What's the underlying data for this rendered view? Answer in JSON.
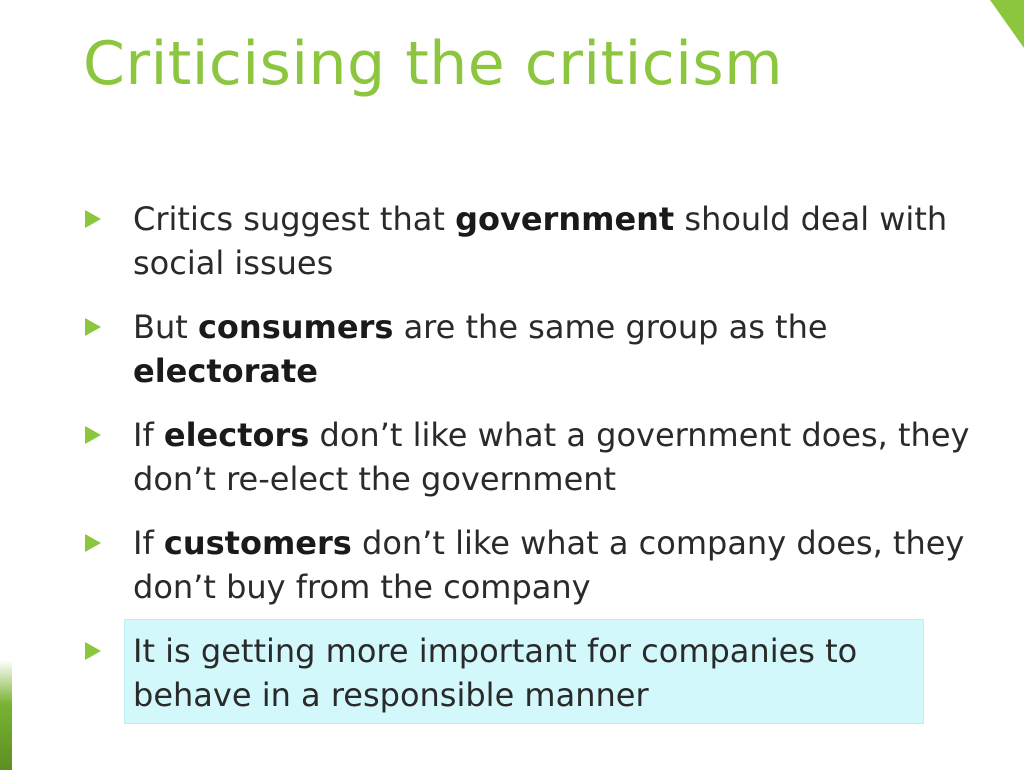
{
  "slide": {
    "title": "Criticising the criticism",
    "colors": {
      "accent": "#8cc63f",
      "text": "#2a2a2a",
      "highlight": "#d3f8fb"
    },
    "bullets": [
      {
        "before": "Critics suggest that ",
        "bold": "government",
        "after": " should deal with social issues"
      },
      {
        "before": "But ",
        "bold": "consumers",
        "middle": " are the same group as the ",
        "bold2": "electorate"
      },
      {
        "before": "If ",
        "bold": "electors",
        "after": " don’t like what a government does, they don’t re-elect the government"
      },
      {
        "before": "If ",
        "bold": "customers",
        "after": " don’t like what a company does, they don’t buy from the company"
      },
      {
        "text": "It is getting more important for companies to behave in a responsible manner",
        "highlighted": true
      }
    ],
    "icons": {
      "bullet": "green-triangle-arrow-icon"
    }
  }
}
